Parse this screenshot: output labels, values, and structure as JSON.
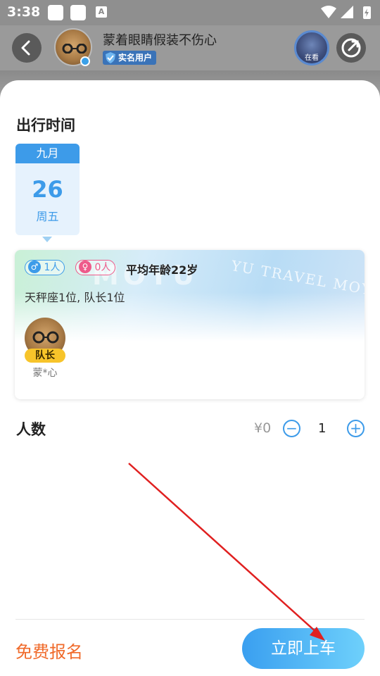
{
  "status_bar": {
    "time": "3:38",
    "notification_letter": "A",
    "icons": [
      "wifi-icon",
      "signal-icon",
      "battery-charging-icon"
    ]
  },
  "header": {
    "back_icon": "chevron-left-icon",
    "user_name": "蒙着眼睛假装不伤心",
    "real_name_badge": "实名用户",
    "watching_label": "在看",
    "share_icon": "share-icon"
  },
  "travel_time": {
    "title": "出行时间",
    "selected_date": {
      "month": "九月",
      "day": "26",
      "weekday": "周五"
    }
  },
  "group": {
    "male_count": "1人",
    "female_count": "0人",
    "average_age": "平均年龄22岁",
    "members_summary": "天秤座1位, 队长1位",
    "watermark": "YU TRAVEL MOYU TR",
    "watermark_big": "MOYU",
    "leader_badge": "队长",
    "leader_name": "蒙*心"
  },
  "people": {
    "label": "人数",
    "price": "¥0",
    "minus_symbol": "−",
    "plus_symbol": "+",
    "quantity": "1"
  },
  "footer": {
    "free_signup": "免费报名",
    "board_now": "立即上车"
  },
  "colors": {
    "accent_blue": "#3d9be9",
    "orange": "#f06a2a",
    "female_pink": "#ee5a8a",
    "leader_yellow": "#f7c42a",
    "annotation_arrow": "#e02020"
  }
}
